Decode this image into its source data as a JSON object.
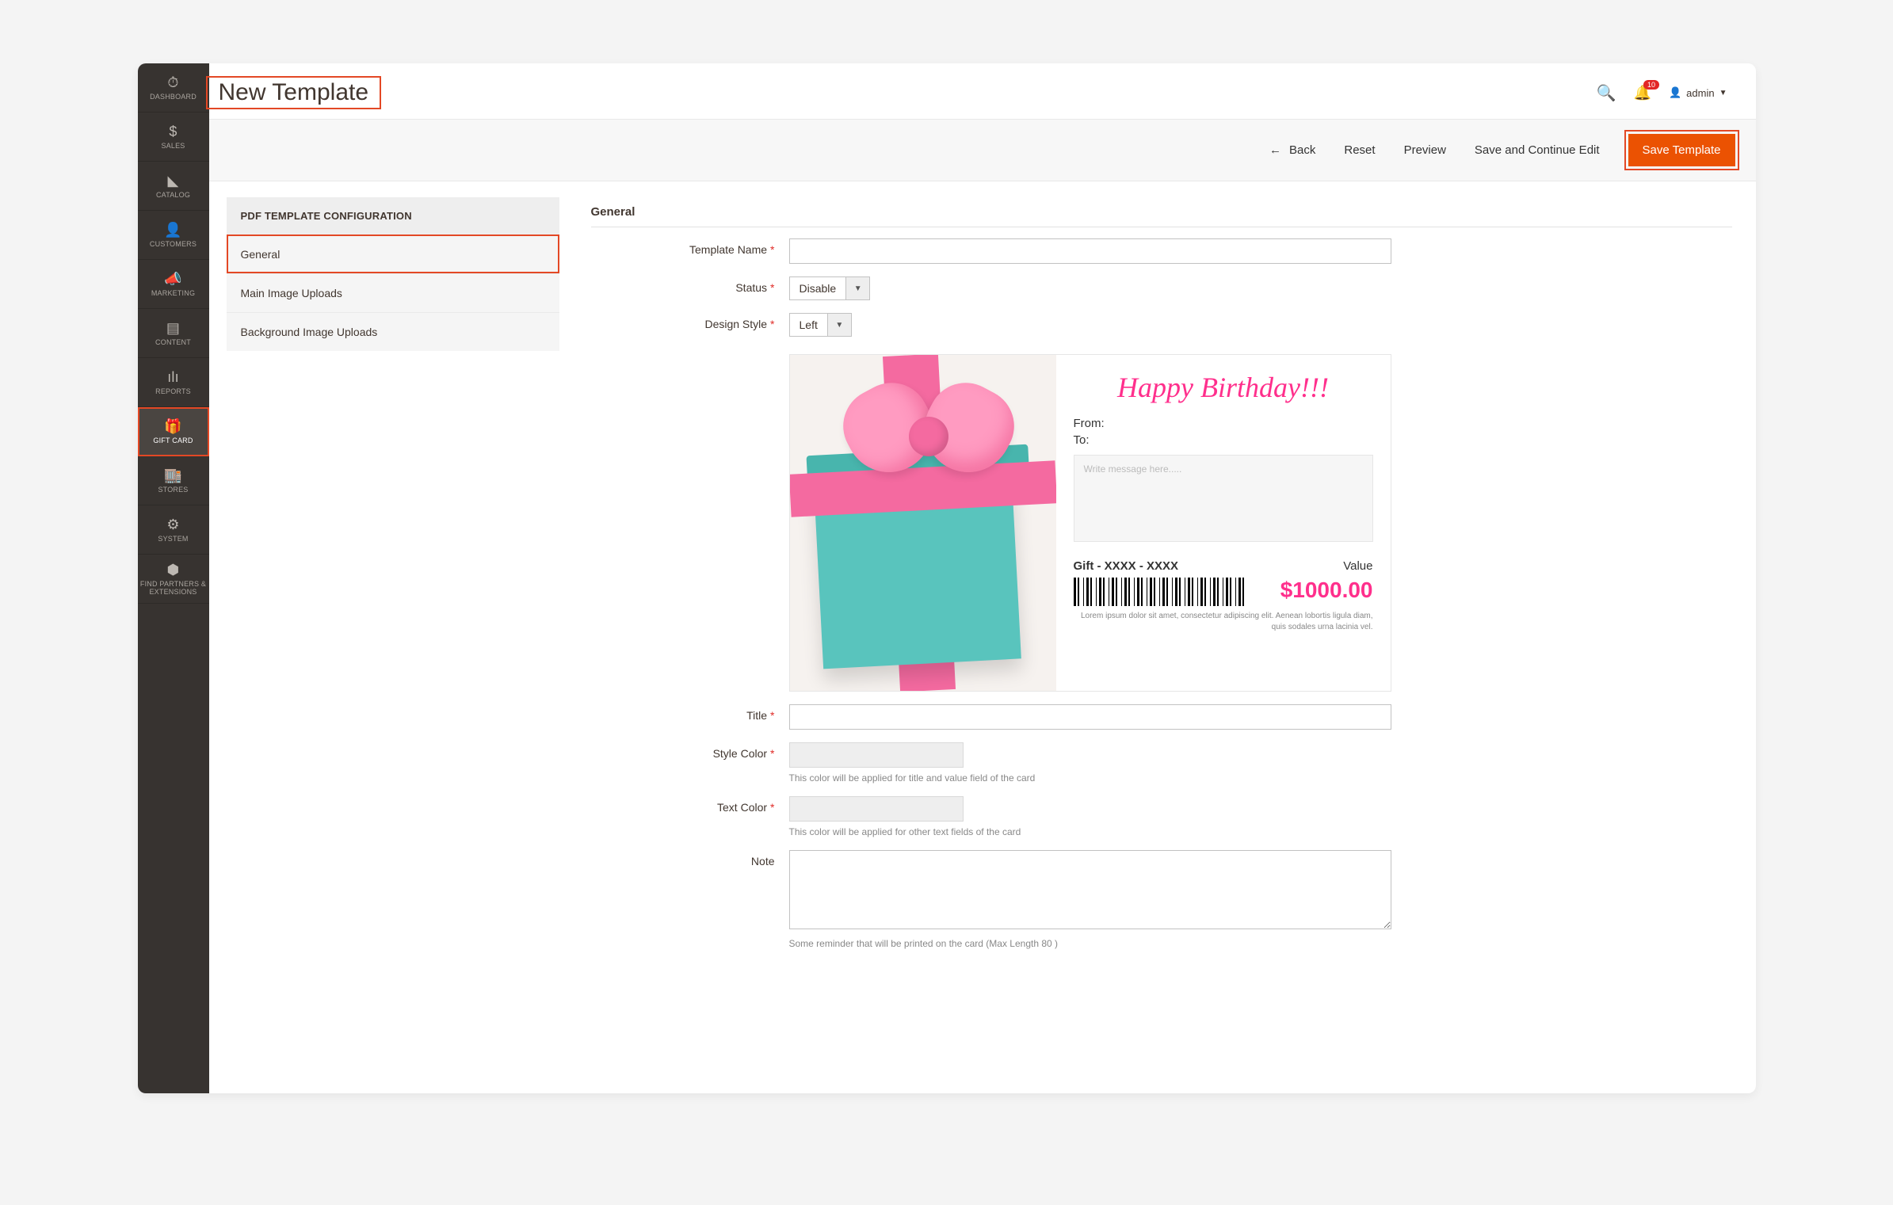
{
  "header": {
    "title": "New Template",
    "notif_count": "10",
    "admin_label": "admin"
  },
  "toolbar": {
    "back": "Back",
    "reset": "Reset",
    "preview": "Preview",
    "save_continue": "Save and Continue Edit",
    "save": "Save Template"
  },
  "sidebar": {
    "items": [
      "DASHBOARD",
      "SALES",
      "CATALOG",
      "CUSTOMERS",
      "MARKETING",
      "CONTENT",
      "REPORTS",
      "GIFT CARD",
      "STORES",
      "SYSTEM",
      "FIND PARTNERS & EXTENSIONS"
    ]
  },
  "leftpanel": {
    "title": "PDF TEMPLATE CONFIGURATION",
    "items": [
      "General",
      "Main Image Uploads",
      "Background Image Uploads"
    ]
  },
  "form": {
    "section_title": "General",
    "labels": {
      "template_name": "Template Name",
      "status": "Status",
      "design_style": "Design Style",
      "title": "Title",
      "style_color": "Style Color",
      "text_color": "Text Color",
      "note": "Note"
    },
    "values": {
      "template_name": "",
      "status": "Disable",
      "design_style": "Left",
      "title": "",
      "note": ""
    },
    "hints": {
      "style_color": "This color will be applied for title and value field of the card",
      "text_color": "This color will be applied for other text fields of the card",
      "note": "Some reminder that will be printed on the card (Max Length 80 )"
    }
  },
  "preview": {
    "headline": "Happy Birthday!!!",
    "from": "From:",
    "to": "To:",
    "msg_placeholder": "Write message here.....",
    "code": "Gift - XXXX - XXXX",
    "value_label": "Value",
    "amount": "$1000.00",
    "lorem": "Lorem ipsum dolor sit amet, consectetur adipiscing elit. Aenean lobortis ligula diam, quis sodales urna lacinia vel."
  }
}
